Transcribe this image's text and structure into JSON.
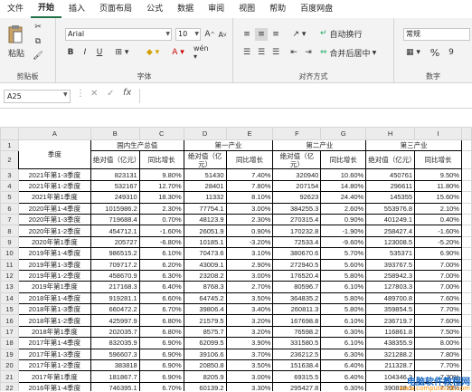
{
  "menu": [
    "文件",
    "开始",
    "插入",
    "页面布局",
    "公式",
    "数据",
    "审阅",
    "视图",
    "帮助",
    "百度网盘"
  ],
  "ribbon": {
    "paste": "粘贴",
    "clipboard": "剪贴板",
    "font_name": "Arial",
    "font_size": "10",
    "font_group": "字体",
    "align_group": "对齐方式",
    "wrap": "自动换行",
    "merge": "合并后居中",
    "number_format": "常规",
    "number_group": "数字"
  },
  "name_box": "A25",
  "fx": "fx",
  "columns": [
    "A",
    "B",
    "C",
    "D",
    "E",
    "F",
    "G",
    "H",
    "I"
  ],
  "header": {
    "quarter": "季度",
    "gdp": "国内生产总值",
    "primary": "第一产业",
    "secondary": "第二产业",
    "tertiary": "第三产业",
    "abs": "绝对值（亿元）",
    "yoy": "同比增长"
  },
  "rows": [
    [
      "2021年第1-3季度",
      "823131",
      "9.80%",
      "51430",
      "7.40%",
      "320940",
      "10.60%",
      "450761",
      "9.50%"
    ],
    [
      "2021年第1-2季度",
      "532167",
      "12.70%",
      "28401",
      "7.80%",
      "207154",
      "14.80%",
      "296611",
      "11.80%"
    ],
    [
      "2021年第1季度",
      "249310",
      "18.30%",
      "11332",
      "8.10%",
      "92623",
      "24.40%",
      "145355",
      "15.60%"
    ],
    [
      "2020年第1-4季度",
      "1015986.2",
      "2.30%",
      "77754.1",
      "3.00%",
      "384255.3",
      "2.60%",
      "553976.8",
      "2.10%"
    ],
    [
      "2020年第1-3季度",
      "719688.4",
      "0.70%",
      "48123.9",
      "2.30%",
      "270315.4",
      "0.90%",
      "401249.1",
      "0.40%"
    ],
    [
      "2020年第1-2季度",
      "454712.1",
      "-1.60%",
      "26051.9",
      "0.90%",
      "170232.8",
      "-1.90%",
      "258427.4",
      "-1.60%"
    ],
    [
      "2020年第1季度",
      "205727",
      "-6.80%",
      "10185.1",
      "-3.20%",
      "72533.4",
      "-9.60%",
      "123008.5",
      "-5.20%"
    ],
    [
      "2019年第1-4季度",
      "986515.2",
      "6.10%",
      "70473.6",
      "3.10%",
      "380670.6",
      "5.70%",
      "535371",
      "6.90%"
    ],
    [
      "2019年第1-3季度",
      "709717.2",
      "6.20%",
      "43009.1",
      "2.90%",
      "272940.5",
      "5.60%",
      "393767.5",
      "7.00%"
    ],
    [
      "2019年第1-2季度",
      "458670.9",
      "6.30%",
      "23208.2",
      "3.00%",
      "176520.4",
      "5.80%",
      "258942.3",
      "7.00%"
    ],
    [
      "2019年第1季度",
      "217168.3",
      "6.40%",
      "8768.3",
      "2.70%",
      "80596.7",
      "6.10%",
      "127803.3",
      "7.00%"
    ],
    [
      "2018年第1-4季度",
      "919281.1",
      "6.60%",
      "64745.2",
      "3.50%",
      "364835.2",
      "5.80%",
      "489700.8",
      "7.60%"
    ],
    [
      "2018年第1-3季度",
      "660472.2",
      "6.70%",
      "39806.4",
      "3.40%",
      "260811.3",
      "5.80%",
      "359854.5",
      "7.70%"
    ],
    [
      "2018年第1-2季度",
      "425997.9",
      "6.80%",
      "21579.5",
      "3.20%",
      "167698.8",
      "6.10%",
      "236719.7",
      "7.60%"
    ],
    [
      "2018年第1季度",
      "202035.7",
      "6.80%",
      "8575.7",
      "3.20%",
      "76598.2",
      "6.30%",
      "116861.8",
      "7.50%"
    ],
    [
      "2017年第1-4季度",
      "832035.9",
      "6.90%",
      "62099.5",
      "3.90%",
      "331580.5",
      "6.10%",
      "438355.9",
      "8.00%"
    ],
    [
      "2017年第1-3季度",
      "596607.3",
      "6.90%",
      "39106.6",
      "3.70%",
      "236212.5",
      "6.30%",
      "321288.2",
      "7.80%"
    ],
    [
      "2017年第1-2季度",
      "383818",
      "6.90%",
      "20850.8",
      "3.50%",
      "151638.4",
      "6.40%",
      "211328.7",
      "7.70%"
    ],
    [
      "2017年第1季度",
      "181867.7",
      "6.90%",
      "8205.9",
      "3.00%",
      "69315.5",
      "6.40%",
      "104346.3",
      "7.70%"
    ],
    [
      "2016年第1-4季度",
      "746395.1",
      "6.70%",
      "60139.2",
      "3.30%",
      "295427.8",
      "6.30%",
      "390828.1",
      "7.70%"
    ]
  ],
  "watermark": "电脑软件教程网",
  "watermark_url": "www.computer26.com"
}
